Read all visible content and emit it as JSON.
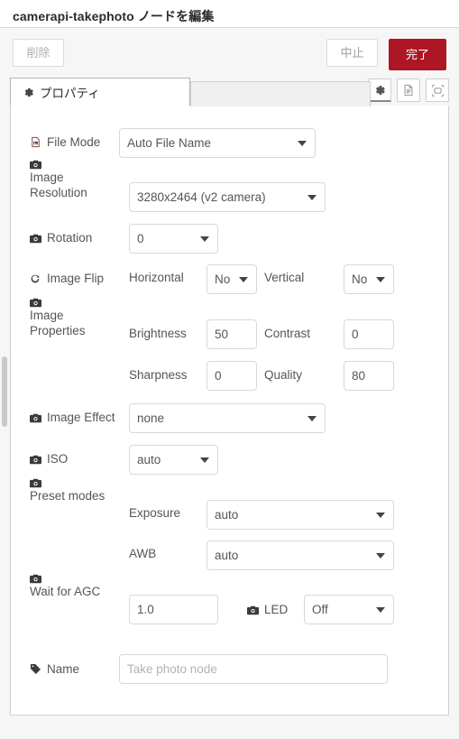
{
  "header": {
    "title": "camerapi-takephoto ノードを編集"
  },
  "toolbar": {
    "delete_label": "削除",
    "cancel_label": "中止",
    "done_label": "完了",
    "done_color": "#ad1625"
  },
  "tabs": {
    "properties_label": "プロパティ",
    "properties_icon": "gear-icon",
    "tools": [
      {
        "name": "gear-icon",
        "active": true
      },
      {
        "name": "description-icon",
        "active": false
      },
      {
        "name": "appearance-icon",
        "active": false
      }
    ]
  },
  "form": {
    "file_mode": {
      "label": "File Mode",
      "icon": "file-image-icon",
      "value": "Auto File Name"
    },
    "image_resolution": {
      "label": "Image Resolution",
      "icon": "camera-icon",
      "value": "3280x2464 (v2 camera)"
    },
    "rotation": {
      "label": "Rotation",
      "icon": "camera-icon",
      "value": "0"
    },
    "image_flip": {
      "label": "Image Flip",
      "icon": "rotate-icon",
      "horizontal_label": "Horizontal",
      "horizontal_value": "No",
      "vertical_label": "Vertical",
      "vertical_value": "No"
    },
    "image_properties": {
      "label": "Image Properties",
      "icon": "camera-icon",
      "brightness_label": "Brightness",
      "brightness_value": "50",
      "contrast_label": "Contrast",
      "contrast_value": "0",
      "sharpness_label": "Sharpness",
      "sharpness_value": "0",
      "quality_label": "Quality",
      "quality_value": "80"
    },
    "image_effect": {
      "label": "Image Effect",
      "icon": "camera-icon",
      "value": "none"
    },
    "iso": {
      "label": "ISO",
      "icon": "camera-icon",
      "value": "auto"
    },
    "preset_modes": {
      "label": "Preset modes",
      "icon": "camera-icon",
      "exposure_label": "Exposure",
      "exposure_value": "auto",
      "awb_label": "AWB",
      "awb_value": "auto"
    },
    "wait_for_agc": {
      "label": "Wait for AGC",
      "icon": "camera-icon",
      "value": "1.0",
      "led_label": "LED",
      "led_icon": "camera-icon",
      "led_value": "Off"
    },
    "name": {
      "label": "Name",
      "icon": "tag-icon",
      "value": "",
      "placeholder": "Take photo node"
    }
  }
}
